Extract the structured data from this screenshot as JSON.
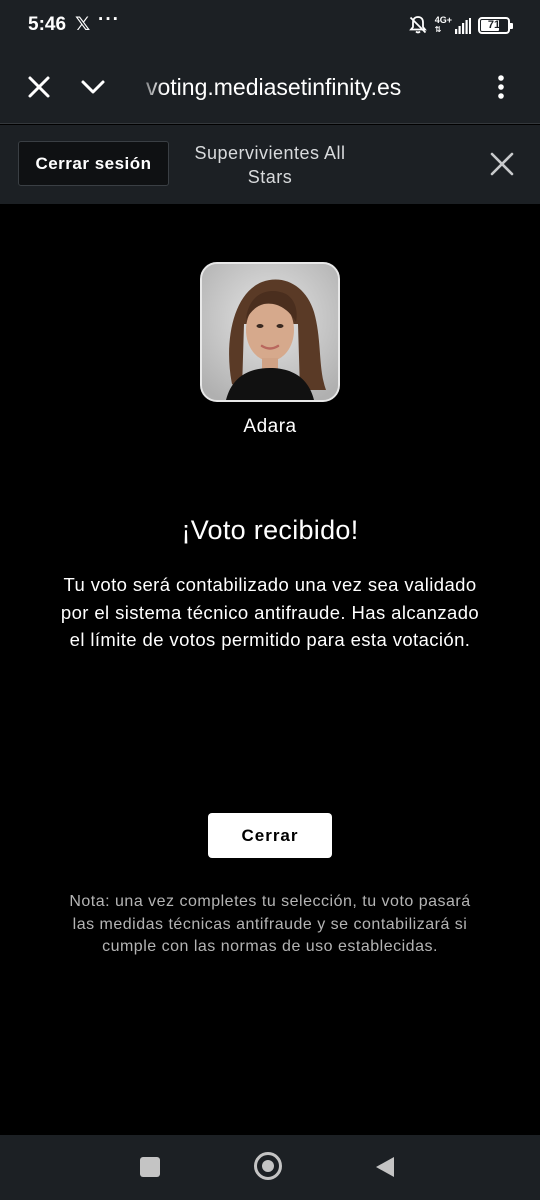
{
  "status_bar": {
    "time": "5:46",
    "app_icon": "x-logo-icon",
    "more": "···",
    "network": "4G+",
    "battery": "71",
    "battery_level_percent": 71
  },
  "browser": {
    "url": "voting.mediasetinfinity.es"
  },
  "header": {
    "logout_label": "Cerrar sesión",
    "title": "Supervivientes All Stars"
  },
  "contestant": {
    "name": "Adara"
  },
  "confirmation": {
    "title": "¡Voto recibido!",
    "message": "Tu voto será contabilizado una vez sea validado por el sistema técnico antifraude. Has alcanzado el límite de votos permitido para esta votación.",
    "close_label": "Cerrar"
  },
  "note": "Nota: una vez completes tu selección, tu voto pasará las medidas técnicas antifraude y se contabilizará si cumple con las normas de uso establecidas.",
  "colors": {
    "background": "#000000",
    "bar_background": "#1c2024",
    "primary_button": "#ffffff",
    "note_text": "#b4b4b4"
  }
}
